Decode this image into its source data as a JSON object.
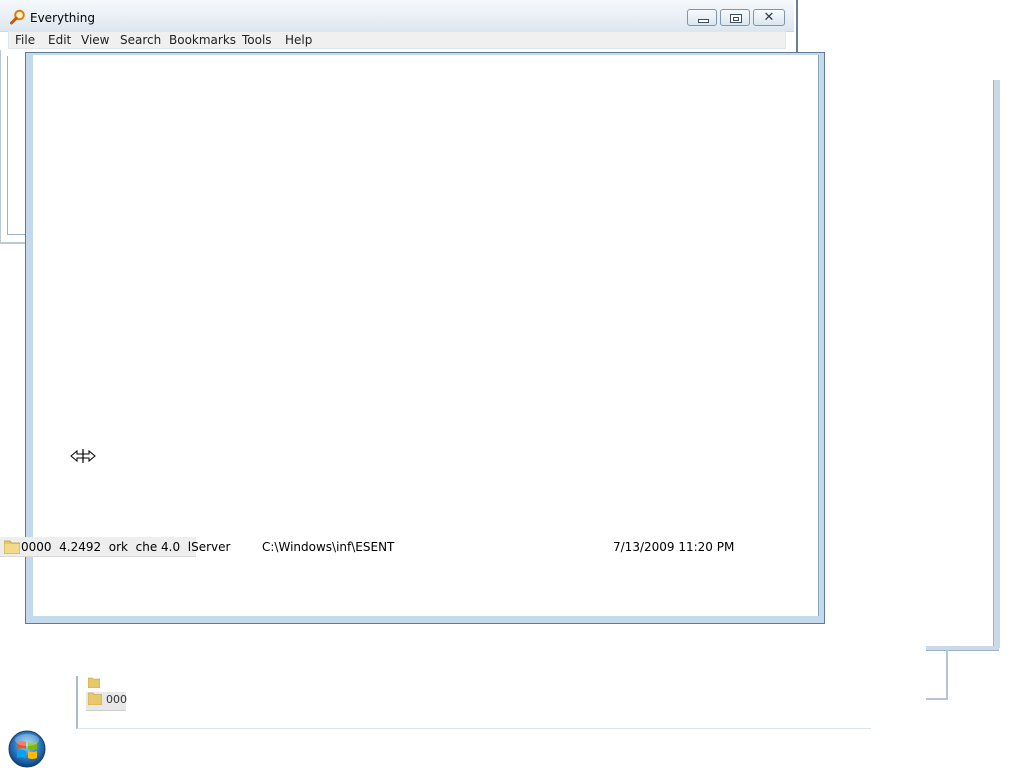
{
  "window": {
    "title": "Everything"
  },
  "menu": [
    "File",
    "Edit",
    "View",
    "Search",
    "Bookmarks",
    "Tools",
    "Help"
  ],
  "result_row": {
    "name": "0000  4.2492  ork  che 4.0  lServer",
    "path": "C:\\Windows\\inf\\ESENT",
    "date_modified": "7/13/2009 11:20 PM"
  },
  "background_fragment_text": "000",
  "colors": {
    "frame": "#c5d9ec",
    "frame_border": "#5e7b98",
    "folder": "#e8c96a"
  },
  "icons": {
    "app": "magnifier-icon",
    "folder": "folder-icon",
    "cursor": "horizontal-resize-cursor-icon",
    "start": "windows-start-orb-icon"
  }
}
